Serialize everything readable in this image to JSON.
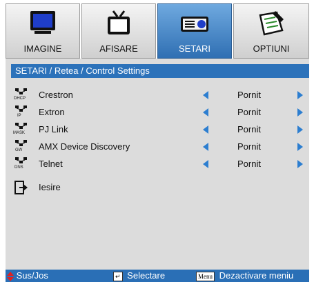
{
  "tabs": [
    {
      "label": "IMAGINE",
      "icon": "monitor-icon",
      "active": false
    },
    {
      "label": "AFISARE",
      "icon": "tv-icon",
      "active": false
    },
    {
      "label": "SETARI",
      "icon": "projector-icon",
      "active": true
    },
    {
      "label": "OPTIUNI",
      "icon": "notepad-icon",
      "active": false
    }
  ],
  "breadcrumb": "SETARI / Retea / Control Settings",
  "rows": [
    {
      "label": "Crestron",
      "value": "Pornit",
      "icon_tag": "DHCP"
    },
    {
      "label": "Extron",
      "value": "Pornit",
      "icon_tag": "IP"
    },
    {
      "label": "PJ Link",
      "value": "Pornit",
      "icon_tag": "MASK"
    },
    {
      "label": "AMX Device Discovery",
      "value": "Pornit",
      "icon_tag": "GW"
    },
    {
      "label": "Telnet",
      "value": "Pornit",
      "icon_tag": "DNS"
    }
  ],
  "exit_label": "Iesire",
  "help": {
    "updown": "Sus/Jos",
    "select": "Selectare",
    "menu_key": "Menu",
    "menu_action": "Dezactivare meniu"
  },
  "colors": {
    "accent": "#2c72ba",
    "panel": "#dcdcdc",
    "arrow": "#2c7ed0"
  }
}
